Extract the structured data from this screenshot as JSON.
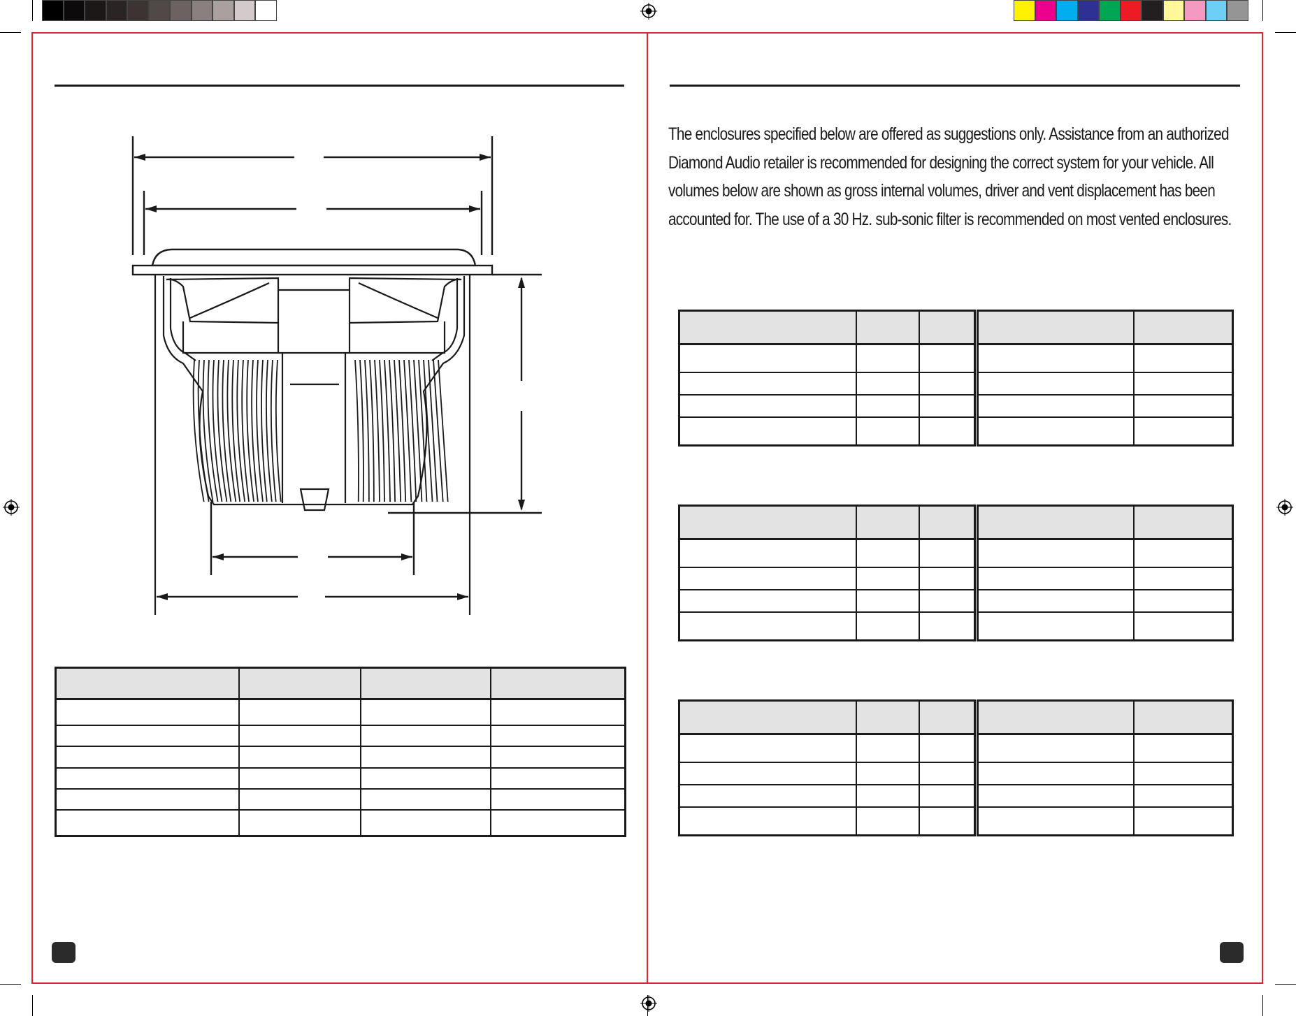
{
  "intro_text": "The enclosures specified below are offered as suggestions only. Assistance from an authorized Diamond Audio retailer is recommended for designing the correct system for your vehicle.  All volumes below are shown as gross internal volumes, driver and vent displacement has been accounted for.  The use of a 30 Hz. sub-sonic filter is recommended on most vented enclosures.",
  "colors": {
    "border": "#e0242b",
    "table_header": "#e3e3e3",
    "ink": "#1a1a1a",
    "gray_bar": [
      "#000000",
      "#0c0a0a",
      "#1c1818",
      "#2a2424",
      "#3b3433",
      "#514947",
      "#6b6261",
      "#8a807f",
      "#aaa09f",
      "#d3cbcb",
      "#ffffff"
    ],
    "color_bar": [
      "#fff200",
      "#ec008c",
      "#00aeef",
      "#2e3192",
      "#00a651",
      "#ed1c24",
      "#231f20",
      "#fff799",
      "#f49ac1",
      "#6dcff6",
      "#959595"
    ]
  },
  "icons": {
    "registration_mark": "crosshair-target-icon",
    "page_tab": "page-number-tab"
  }
}
